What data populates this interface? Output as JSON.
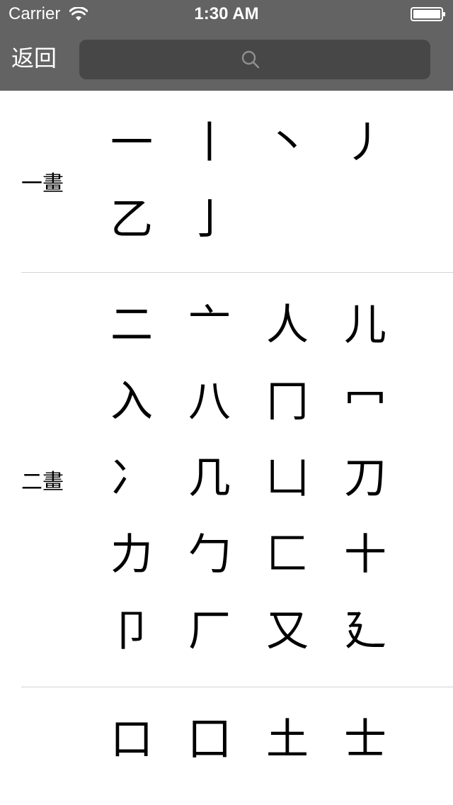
{
  "status_bar": {
    "carrier": "Carrier",
    "time": "1:30 AM",
    "wifi_icon": "wifi-icon",
    "battery_icon": "battery-icon"
  },
  "nav": {
    "back_label": "返回",
    "search_placeholder": "",
    "search_icon": "search-icon"
  },
  "colors": {
    "topbar": "#636363",
    "search_field": "#474747",
    "divider": "#d4d4d4"
  },
  "sections": [
    {
      "label": "一畫",
      "radicals": [
        "一",
        "丨",
        "丶",
        "丿",
        "乙",
        "亅"
      ]
    },
    {
      "label": "二畫",
      "radicals": [
        "二",
        "亠",
        "人",
        "儿",
        "入",
        "八",
        "冂",
        "冖",
        "冫",
        "几",
        "凵",
        "刀",
        "力",
        "勹",
        "匚",
        "十",
        "卩",
        "厂",
        "又",
        "廴"
      ]
    },
    {
      "label": "",
      "radicals": [
        "口",
        "囗",
        "土",
        "士"
      ]
    }
  ]
}
